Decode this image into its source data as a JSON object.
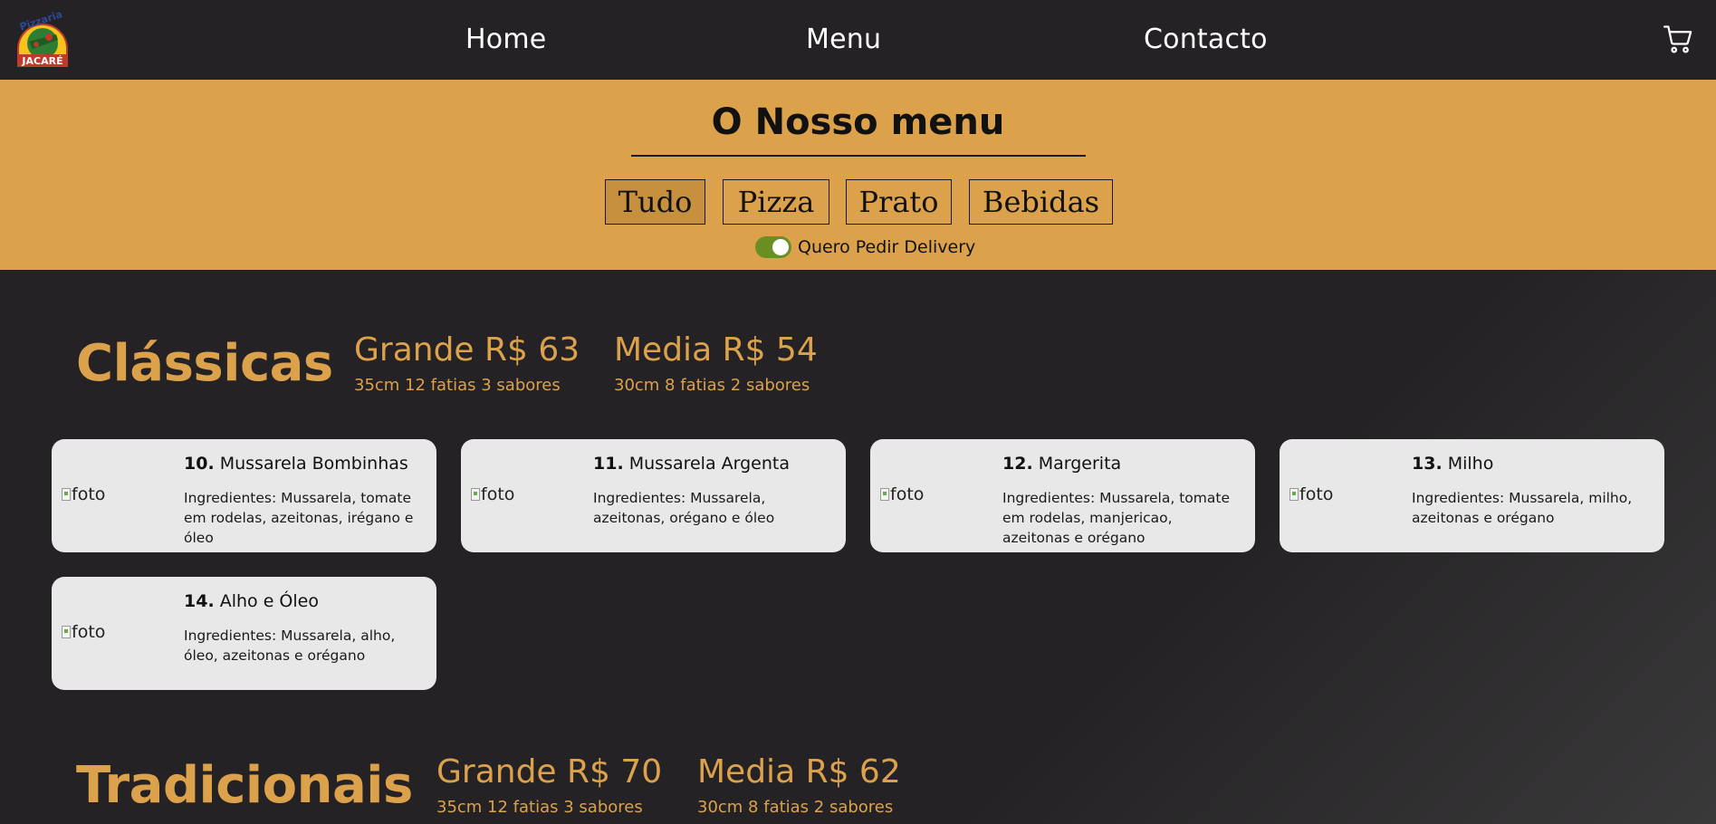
{
  "navbar": {
    "logo": {
      "top_text": "Pizzaria",
      "bottom_text": "JACARÉ"
    },
    "links": [
      "Home",
      "Menu",
      "Contacto"
    ],
    "cart_icon": "cart-icon"
  },
  "menu_header": {
    "title": "O Nosso menu",
    "filters": [
      "Tudo",
      "Pizza",
      "Prato",
      "Bebidas"
    ],
    "active_filter": "Tudo",
    "delivery_label": "Quero Pedir Delivery",
    "delivery_on": true
  },
  "colors": {
    "nav_bg": "#242224",
    "accent": "#dca24b",
    "active_filter": "#c6903f",
    "toggle": "#6b8e23",
    "card_bg": "#e8e8e8"
  },
  "categories": [
    {
      "name": "Clássicas",
      "sizes": [
        {
          "title": "Grande R$ 63",
          "sub": "35cm 12 fatias 3 sabores"
        },
        {
          "title": "Media R$ 54",
          "sub": "30cm 8 fatias 2 sabores"
        }
      ],
      "items": [
        {
          "num": "10.",
          "name": "Mussarela Bombinhas",
          "img_alt": "foto",
          "desc": "Ingredientes: Mussarela, tomate em rodelas, azeitonas, irégano e óleo"
        },
        {
          "num": "11.",
          "name": "Mussarela Argenta",
          "img_alt": "foto",
          "desc": "Ingredientes: Mussarela, azeitonas, orégano e óleo"
        },
        {
          "num": "12.",
          "name": "Margerita",
          "img_alt": "foto",
          "desc": "Ingredientes: Mussarela, tomate em rodelas, manjericao, azeitonas e orégano"
        },
        {
          "num": "13.",
          "name": "Milho",
          "img_alt": "foto",
          "desc": "Ingredientes: Mussarela, milho, azeitonas e orégano"
        },
        {
          "num": "14.",
          "name": "Alho e Óleo",
          "img_alt": "foto",
          "desc": "Ingredientes: Mussarela, alho, óleo, azeitonas e orégano"
        }
      ]
    },
    {
      "name": "Tradicionais",
      "sizes": [
        {
          "title": "Grande R$ 70",
          "sub": "35cm 12 fatias 3 sabores"
        },
        {
          "title": "Media R$ 62",
          "sub": "30cm 8 fatias 2 sabores"
        }
      ],
      "items": []
    }
  ]
}
